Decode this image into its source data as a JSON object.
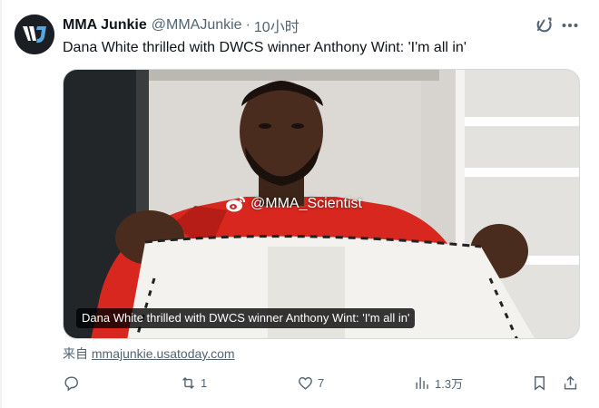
{
  "tweet": {
    "author_name": "MMA Junkie",
    "author_handle": "@MMAJunkie",
    "separator": "·",
    "time": "10小时",
    "text": "Dana White thrilled with DWCS winner Anthony Wint: 'I'm all in'",
    "avatar_icon": "mma-junkie-logo",
    "more_icon": "more-dots-icon",
    "grok_icon": "grok-icon"
  },
  "card": {
    "caption": "Dana White thrilled with DWCS winner Anthony Wint: 'I'm all in'",
    "watermark": "@MMA_Scientist",
    "watermark_icon": "weibo-icon"
  },
  "source": {
    "prefix": "来自",
    "domain": "mmajunkie.usatoday.com"
  },
  "actions": {
    "reply": {
      "icon": "reply-icon",
      "count": ""
    },
    "retweet": {
      "icon": "retweet-icon",
      "count": "1"
    },
    "like": {
      "icon": "heart-icon",
      "count": "7"
    },
    "views": {
      "icon": "views-icon",
      "count": "1.3万"
    },
    "bookmark": {
      "icon": "bookmark-icon"
    },
    "share": {
      "icon": "share-icon"
    }
  },
  "colors": {
    "text_primary": "#0f1419",
    "text_secondary": "#536471",
    "border": "#cfd9de",
    "hoodie_red": "#d8271f"
  }
}
